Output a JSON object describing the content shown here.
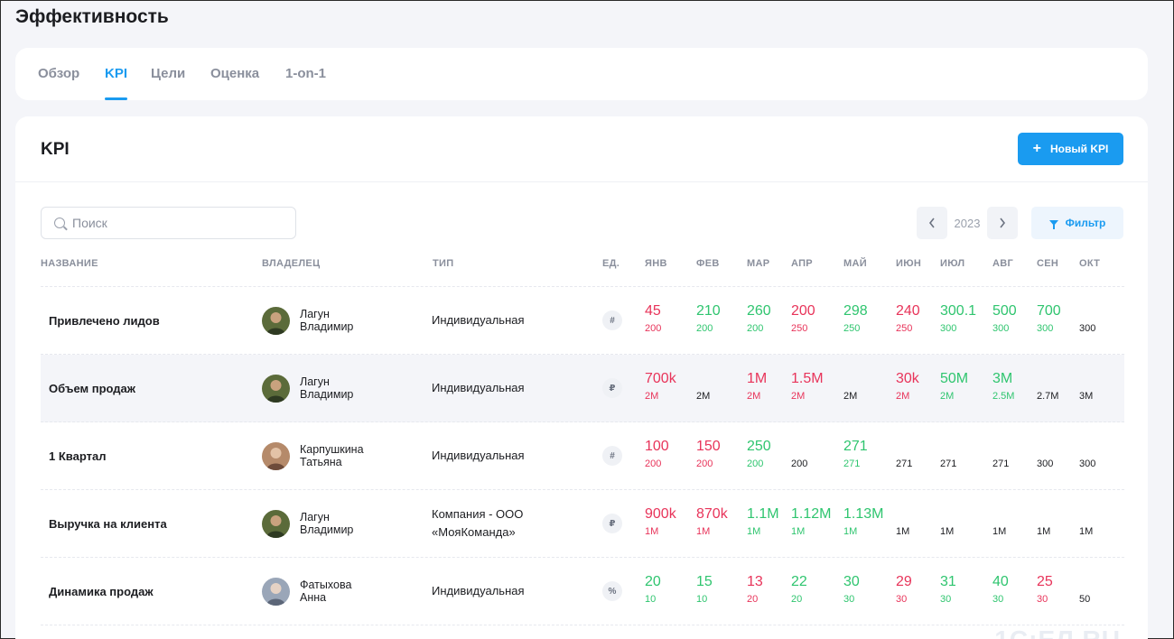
{
  "page_title": "Эффективность",
  "tabs": [
    {
      "label": "Обзор",
      "active": false
    },
    {
      "label": "KPI",
      "active": true
    },
    {
      "label": "Цели",
      "active": false
    },
    {
      "label": "Оценка",
      "active": false
    },
    {
      "label": "1-on-1",
      "active": false
    }
  ],
  "section": {
    "title": "KPI",
    "new_button": "Новый KPI",
    "search_placeholder": "Поиск",
    "year": "2023",
    "filter_button": "Фильтр"
  },
  "columns": {
    "name": "НАЗВАНИЕ",
    "owner": "ВЛАДЕЛЕЦ",
    "type": "ТИП",
    "unit": "ЕД.",
    "months": [
      "ЯНВ",
      "ФЕВ",
      "МАР",
      "АПР",
      "МАЙ",
      "ИЮН",
      "ИЮЛ",
      "АВГ",
      "СЕН",
      "ОКТ"
    ]
  },
  "colors": {
    "accent": "#1a9bf0",
    "negative": "#e8345a",
    "positive": "#2fc56f"
  },
  "rows": [
    {
      "name": "Привлечено лидов",
      "owner_first": "Лагун",
      "owner_last": "Владимир",
      "type": [
        "Индивидуальная"
      ],
      "unit": "#",
      "months": [
        {
          "v": "45",
          "t": "200",
          "s": "red"
        },
        {
          "v": "210",
          "t": "200",
          "s": "green"
        },
        {
          "v": "260",
          "t": "200",
          "s": "green"
        },
        {
          "v": "200",
          "t": "250",
          "s": "red"
        },
        {
          "v": "298",
          "t": "250",
          "s": "green"
        },
        {
          "v": "240",
          "t": "250",
          "s": "red"
        },
        {
          "v": "300.1",
          "t": "300",
          "s": "green"
        },
        {
          "v": "500",
          "t": "300",
          "s": "green"
        },
        {
          "v": "700",
          "t": "300",
          "s": "green"
        },
        {
          "v": "",
          "t": "300",
          "s": "dark"
        }
      ]
    },
    {
      "name": "Объем продаж",
      "owner_first": "Лагун",
      "owner_last": "Владимир",
      "type": [
        "Индивидуальная"
      ],
      "unit": "₽",
      "months": [
        {
          "v": "700k",
          "t": "2M",
          "s": "red"
        },
        {
          "v": "",
          "t": "2M",
          "s": "dark"
        },
        {
          "v": "1M",
          "t": "2M",
          "s": "red"
        },
        {
          "v": "1.5M",
          "t": "2M",
          "s": "red"
        },
        {
          "v": "",
          "t": "2M",
          "s": "dark"
        },
        {
          "v": "30k",
          "t": "2M",
          "s": "red"
        },
        {
          "v": "50M",
          "t": "2M",
          "s": "green"
        },
        {
          "v": "3M",
          "t": "2.5M",
          "s": "green"
        },
        {
          "v": "",
          "t": "2.7M",
          "s": "dark"
        },
        {
          "v": "",
          "t": "3M",
          "s": "dark"
        }
      ]
    },
    {
      "name": "1 Квартал",
      "owner_first": "Карпушкина",
      "owner_last": "Татьяна",
      "type": [
        "Индивидуальная"
      ],
      "unit": "#",
      "months": [
        {
          "v": "100",
          "t": "200",
          "s": "red"
        },
        {
          "v": "150",
          "t": "200",
          "s": "red"
        },
        {
          "v": "250",
          "t": "200",
          "s": "green"
        },
        {
          "v": "",
          "t": "200",
          "s": "dark"
        },
        {
          "v": "271",
          "t": "271",
          "s": "green"
        },
        {
          "v": "",
          "t": "271",
          "s": "dark"
        },
        {
          "v": "",
          "t": "271",
          "s": "dark"
        },
        {
          "v": "",
          "t": "271",
          "s": "dark"
        },
        {
          "v": "",
          "t": "300",
          "s": "dark"
        },
        {
          "v": "",
          "t": "300",
          "s": "dark"
        }
      ]
    },
    {
      "name": "Выручка на клиента",
      "owner_first": "Лагун",
      "owner_last": "Владимир",
      "type": [
        "Компания - ООО",
        "«МояКоманда»"
      ],
      "unit": "₽",
      "months": [
        {
          "v": "900k",
          "t": "1M",
          "s": "red"
        },
        {
          "v": "870k",
          "t": "1M",
          "s": "red"
        },
        {
          "v": "1.1M",
          "t": "1M",
          "s": "green"
        },
        {
          "v": "1.12M",
          "t": "1M",
          "s": "green"
        },
        {
          "v": "1.13M",
          "t": "1M",
          "s": "green"
        },
        {
          "v": "",
          "t": "1M",
          "s": "dark"
        },
        {
          "v": "",
          "t": "1M",
          "s": "dark"
        },
        {
          "v": "",
          "t": "1M",
          "s": "dark"
        },
        {
          "v": "",
          "t": "1M",
          "s": "dark"
        },
        {
          "v": "",
          "t": "1M",
          "s": "dark"
        }
      ]
    },
    {
      "name": "Динамика продаж",
      "owner_first": "Фатыхова",
      "owner_last": "Анна",
      "type": [
        "Индивидуальная"
      ],
      "unit": "%",
      "months": [
        {
          "v": "20",
          "t": "10",
          "s": "green"
        },
        {
          "v": "15",
          "t": "10",
          "s": "green"
        },
        {
          "v": "13",
          "t": "20",
          "s": "red"
        },
        {
          "v": "22",
          "t": "20",
          "s": "green"
        },
        {
          "v": "30",
          "t": "30",
          "s": "green"
        },
        {
          "v": "29",
          "t": "30",
          "s": "red"
        },
        {
          "v": "31",
          "t": "30",
          "s": "green"
        },
        {
          "v": "40",
          "t": "30",
          "s": "green"
        },
        {
          "v": "25",
          "t": "30",
          "s": "red"
        },
        {
          "v": "",
          "t": "50",
          "s": "dark"
        }
      ]
    }
  ]
}
